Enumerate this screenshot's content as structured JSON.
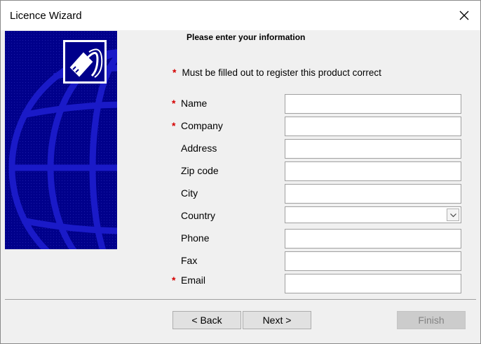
{
  "window": {
    "title": "Licence Wizard"
  },
  "form": {
    "heading": "Please enter your information",
    "required_note": "Must be filled out to register this product correct",
    "required_marker": "*",
    "fields": [
      {
        "label": "Name",
        "required": true,
        "value": ""
      },
      {
        "label": "Company",
        "required": true,
        "value": ""
      },
      {
        "label": "Address",
        "required": false,
        "value": ""
      },
      {
        "label": "Zip code",
        "required": false,
        "value": ""
      },
      {
        "label": "City",
        "required": false,
        "value": ""
      },
      {
        "label": "Country",
        "required": false,
        "value": ""
      },
      {
        "label": "Phone",
        "required": false,
        "value": ""
      },
      {
        "label": "Fax",
        "required": false,
        "value": ""
      },
      {
        "label": "Email",
        "required": true,
        "value": ""
      }
    ]
  },
  "buttons": {
    "back": "< Back",
    "next": "Next >",
    "finish": "Finish"
  },
  "icons": {
    "close": "close-icon",
    "banner": "network-cable-icon",
    "dropdown": "chevron-down-icon"
  },
  "colors": {
    "banner": "#00008b",
    "required": "#d40000"
  }
}
